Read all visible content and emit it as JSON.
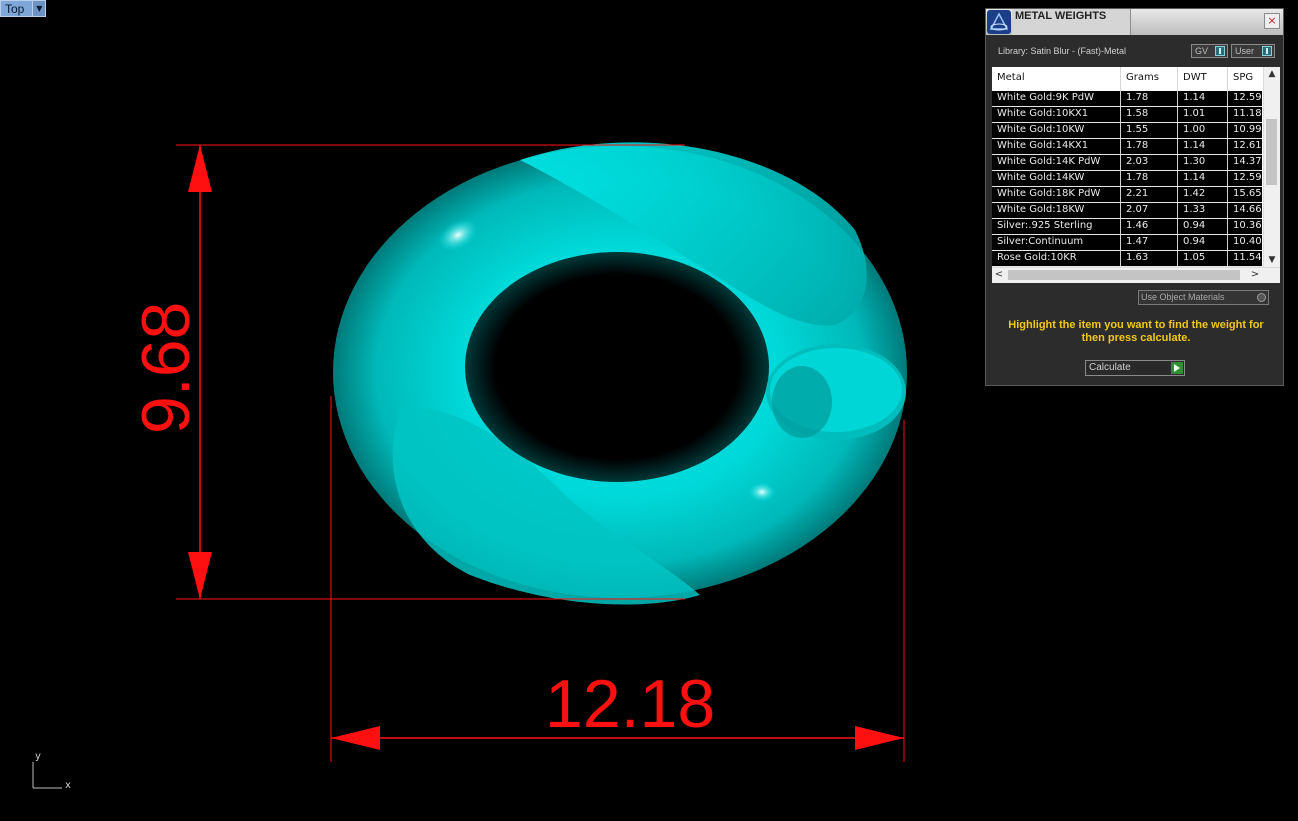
{
  "viewport": {
    "name": "Top"
  },
  "dimensions": {
    "width": "12.18",
    "height": "9.68"
  },
  "axis": {
    "y": "y",
    "x": "x"
  },
  "panel": {
    "title": "METAL WEIGHTS",
    "close": "×",
    "library": "Library: Satin Blur - (Fast)-Metal",
    "toggle_gv": "GV",
    "toggle_user": "User",
    "columns": [
      "Metal",
      "Grams",
      "DWT",
      "SPG"
    ],
    "rows": [
      [
        "White Gold:9K PdW",
        "1.78",
        "1.14",
        "12.59"
      ],
      [
        "White Gold:10KX1",
        "1.58",
        "1.01",
        "11.18"
      ],
      [
        "White Gold:10KW",
        "1.55",
        "1.00",
        "10.99"
      ],
      [
        "White Gold:14KX1",
        "1.78",
        "1.14",
        "12.61"
      ],
      [
        "White Gold:14K PdW",
        "2.03",
        "1.30",
        "14.37"
      ],
      [
        "White Gold:14KW",
        "1.78",
        "1.14",
        "12.59"
      ],
      [
        "White Gold:18K PdW",
        "2.21",
        "1.42",
        "15.65"
      ],
      [
        "White Gold:18KW",
        "2.07",
        "1.33",
        "14.66"
      ],
      [
        "Silver:.925 Sterling",
        "1.46",
        "0.94",
        "10.36"
      ],
      [
        "Silver:Continuum",
        "1.47",
        "0.94",
        "10.40"
      ],
      [
        "Rose Gold:10KR",
        "1.63",
        "1.05",
        "11.54"
      ]
    ],
    "use_object_materials": "Use Object Materials",
    "hint": "Highlight the item you want to find the weight for then press calculate.",
    "calculate": "Calculate"
  },
  "colors": {
    "model": "#00e5e5",
    "dimension": "#ff1010",
    "hint": "#f2c71b"
  }
}
